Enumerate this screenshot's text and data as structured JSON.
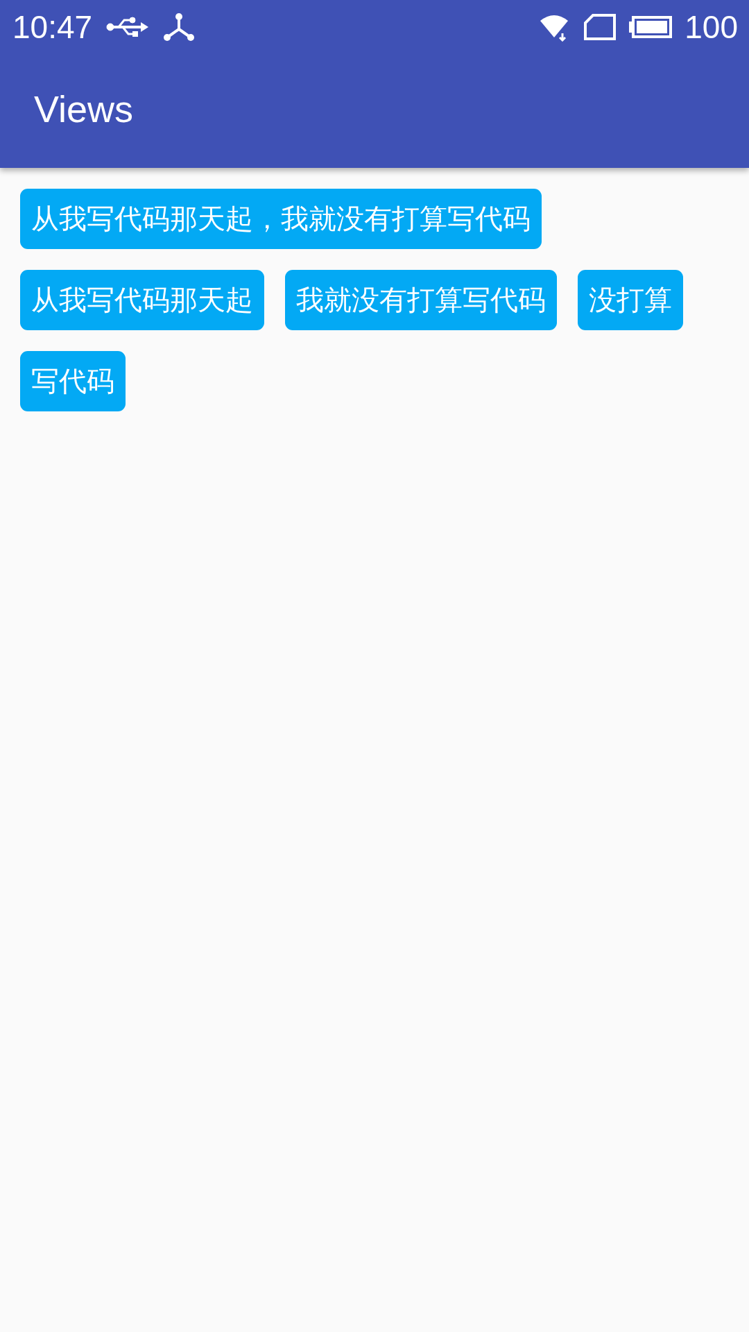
{
  "status_bar": {
    "time": "10:47",
    "battery": "100"
  },
  "app_bar": {
    "title": "Views"
  },
  "tags": [
    {
      "label": "从我写代码那天起，我就没有打算写代码"
    },
    {
      "label": "从我写代码那天起"
    },
    {
      "label": "我就没有打算写代码"
    },
    {
      "label": "没打算"
    },
    {
      "label": "写代码"
    }
  ]
}
